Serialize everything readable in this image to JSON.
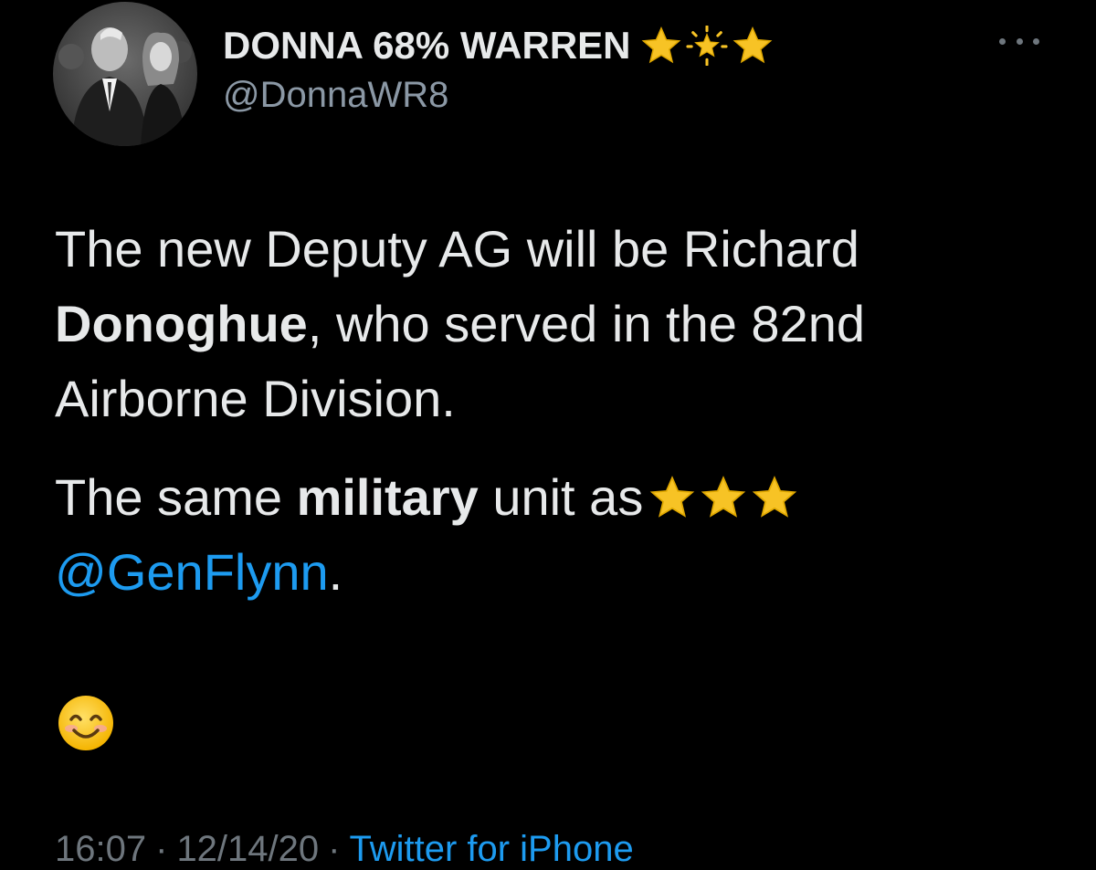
{
  "user": {
    "display_name": "DONNA 68% WARREN",
    "name_emojis": [
      "star-icon",
      "glowing-star-icon",
      "star-icon"
    ],
    "handle": "@DonnaWR8"
  },
  "tweet": {
    "line1_text": "The new Deputy AG will be Richard ",
    "line1_bold": "Donoghue",
    "line1_rest": ", who served in the 82nd Airborne Division.",
    "line2_pre": "The same ",
    "line2_bold": "military",
    "line2_post": " unit as",
    "line2_emojis": [
      "star-icon",
      "star-icon",
      "star-icon"
    ],
    "mention": "@GenFlynn",
    "mention_suffix": ".",
    "closing_emoji": "smiling-face-icon"
  },
  "meta": {
    "time": "16:07",
    "separator": "·",
    "date": "12/14/20",
    "source": "Twitter for iPhone"
  },
  "colors": {
    "background": "#000000",
    "text": "#e7e9ea",
    "secondary": "#8b98a5",
    "link": "#1d9bf0",
    "star": "#f7c325"
  }
}
